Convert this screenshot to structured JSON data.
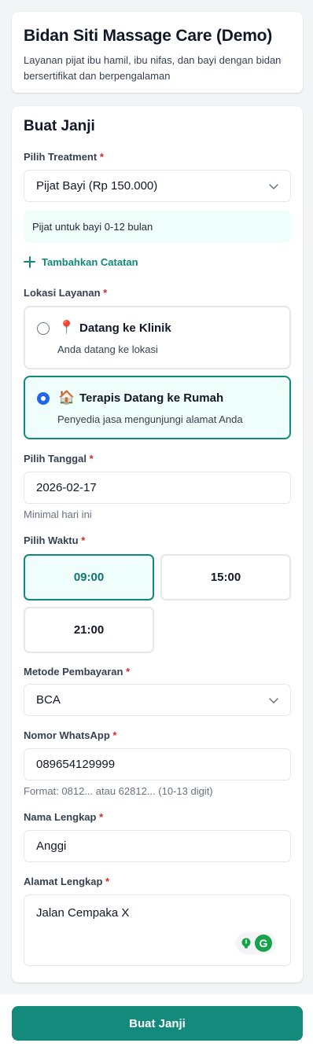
{
  "header": {
    "title": "Bidan Siti Massage Care (Demo)",
    "subtitle": "Layanan pijat ibu hamil, ibu nifas, dan bayi dengan bidan bersertifikat dan berpengalaman"
  },
  "form": {
    "title": "Buat Janji",
    "required_mark": "*",
    "treatment": {
      "label": "Pilih Treatment",
      "value": "Pijat Bayi (Rp 150.000)",
      "icon": "chevron-down-icon",
      "info": "Pijat untuk bayi 0-12 bulan"
    },
    "add_note_label": "Tambahkan Catatan",
    "location": {
      "label": "Lokasi Layanan",
      "options": [
        {
          "emoji": "📍",
          "title": "Datang ke Klinik",
          "desc": "Anda datang ke lokasi",
          "selected": false
        },
        {
          "emoji": "🏠",
          "title": "Terapis Datang ke Rumah",
          "desc": "Penyedia jasa mengunjungi alamat Anda",
          "selected": true
        }
      ]
    },
    "date": {
      "label": "Pilih Tanggal",
      "value": "2026-02-17",
      "hint": "Minimal hari ini"
    },
    "time": {
      "label": "Pilih Waktu",
      "slots": [
        {
          "value": "09:00",
          "selected": true
        },
        {
          "value": "15:00",
          "selected": false
        },
        {
          "value": "21:00",
          "selected": false
        }
      ]
    },
    "payment": {
      "label": "Metode Pembayaran",
      "value": "BCA"
    },
    "whatsapp": {
      "label": "Nomor WhatsApp",
      "value": "089654129999",
      "hint": "Format: 0812... atau 62812... (10-13 digit)"
    },
    "name": {
      "label": "Nama Lengkap",
      "value": "Anggi"
    },
    "address": {
      "label": "Alamat Lengkap",
      "value": "Jalan Cempaka X",
      "widget_icon": "grammarly-icon",
      "widget_letter": "G"
    }
  },
  "submit_label": "Buat Janji",
  "colors": {
    "accent": "#138a7c",
    "accent_light": "#effdfb",
    "required": "#dc2626",
    "radio_selected": "#2563eb"
  }
}
